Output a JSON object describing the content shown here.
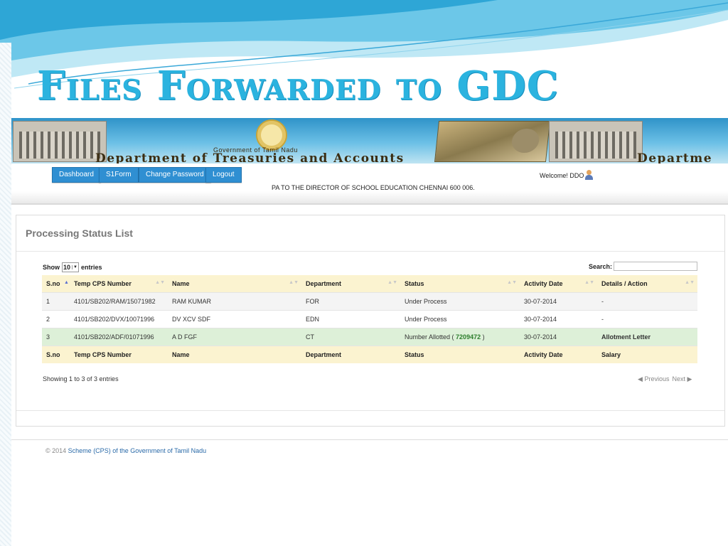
{
  "slide_title": "Files Forwarded to GDC",
  "banner": {
    "gov_text": "Government of Tamil Nadu",
    "dept_text": "Department of Treasuries and Accounts",
    "dept_text_repeat": "Departme"
  },
  "nav": {
    "buttons": [
      "Dashboard",
      "S1Form",
      "Change Password",
      "Logout"
    ],
    "office": "PA TO THE DIRECTOR OF SCHOOL EDUCATION CHENNAI 600 006.",
    "welcome": "Welcome! DDO"
  },
  "panel": {
    "title": "Processing Status List",
    "show_label": "Show",
    "entries_value": "10",
    "entries_label": "entries",
    "search_label": "Search:",
    "search_value": ""
  },
  "table": {
    "headers": [
      "S.no",
      "Temp CPS Number",
      "Name",
      "Department",
      "Status",
      "Activity Date",
      "Details / Action"
    ],
    "rows": [
      {
        "sno": "1",
        "cps": "4101/SB202/RAM/15071982",
        "name": "RAM KUMAR",
        "dept": "FOR",
        "status": "Under Process",
        "status_code": "",
        "status_close": "",
        "date": "30-07-2014",
        "action": "-"
      },
      {
        "sno": "2",
        "cps": "4101/SB202/DVX/10071996",
        "name": "DV XCV SDF",
        "dept": "EDN",
        "status": "Under Process",
        "status_code": "",
        "status_close": "",
        "date": "30-07-2014",
        "action": "-"
      },
      {
        "sno": "3",
        "cps": "4101/SB202/ADF/01071996",
        "name": "A D FGF",
        "dept": "CT",
        "status": "Number Allotted (",
        "status_code": "7209472",
        "status_close": ")",
        "date": "30-07-2014",
        "action": "Allotment Letter"
      }
    ],
    "footer": [
      "S.no",
      "Temp CPS Number",
      "Name",
      "Department",
      "Status",
      "Activity Date",
      "Salary"
    ]
  },
  "pagination": {
    "info": "Showing 1 to 3 of 3 entries",
    "previous": "Previous",
    "next": "Next"
  },
  "footer": {
    "copyright": "© 2014",
    "text": "Scheme (CPS) of the Government of Tamil Nadu"
  },
  "colors": {
    "title": "#2bb3df",
    "nav_button": "#2f8fd2",
    "header_row": "#fbf3d0",
    "allotted_row": "#ddf0d8",
    "link": "#2a6aa8"
  }
}
